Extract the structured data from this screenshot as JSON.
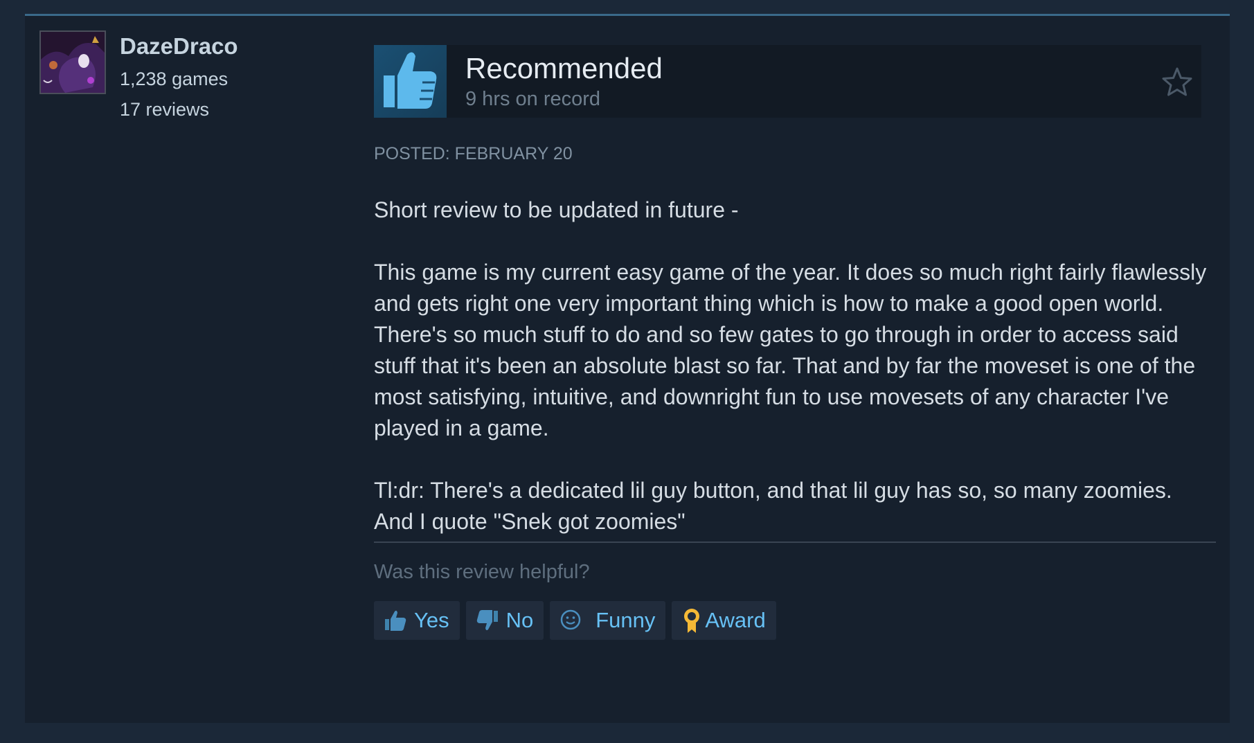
{
  "author": {
    "name": "DazeDraco",
    "games": "1,238 games",
    "reviews": "17 reviews",
    "avatar_icon": "avatar-image"
  },
  "verdict": {
    "title": "Recommended",
    "hours": "9 hrs on record",
    "icon": "thumbs-up-icon",
    "favorite_icon": "star-icon"
  },
  "posted": "POSTED: FEBRUARY 20",
  "review_text": "Short review to be updated in future -\n\nThis game is my current easy game of the year. It does so much right fairly flawlessly and gets right one very important thing which is how to make a good open world. There's so much stuff to do and so few gates to go through in order to access said stuff that it's been an absolute blast so far. That and by far the moveset is one of the most satisfying, intuitive, and downright fun to use movesets of any character I've played in a game.\n\nTl:dr: There's a dedicated lil guy button, and that lil guy has so, so many zoomies. And I quote \"Snek got zoomies\"",
  "helpful_prompt": "Was this review helpful?",
  "buttons": {
    "yes": "Yes",
    "no": "No",
    "funny": "Funny",
    "award": "Award"
  },
  "colors": {
    "background": "#1b2838",
    "card": "#16202d",
    "link_blue": "#67c1f5",
    "thumb_blue": "#5db9ec",
    "award_gold": "#f5b936"
  }
}
